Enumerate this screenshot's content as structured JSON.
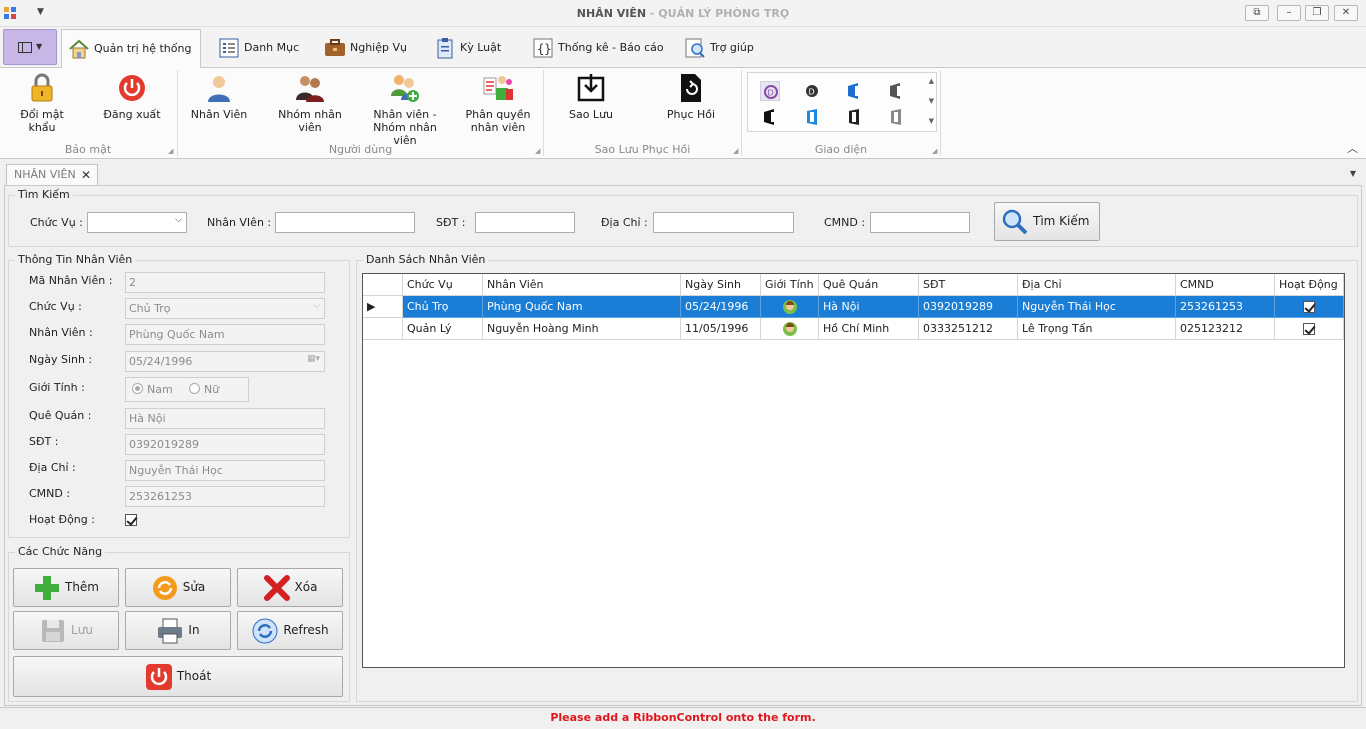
{
  "window": {
    "title_main": "NHÂN VIÊN",
    "title_sep": " - ",
    "title_sub": "QUẢN LÝ PHÒNG TRỌ",
    "buttons": [
      "restore-window",
      "minimize",
      "maximize",
      "close"
    ]
  },
  "tabs": [
    {
      "label": "Quản trị hệ thống",
      "active": true
    },
    {
      "label": "Danh Mục"
    },
    {
      "label": "Nghiệp Vụ"
    },
    {
      "label": "Kỳ Luật"
    },
    {
      "label": "Thống kê - Báo cáo"
    },
    {
      "label": "Trợ giúp"
    }
  ],
  "ribbon": {
    "groups": {
      "security": "Bảo mật",
      "users": "Người dùng",
      "backup": "Sao Lưu  Phục Hồi",
      "theme": "Giao diện"
    },
    "buttons": {
      "change_password": "Đổi mật khẩu",
      "logout": "Đăng xuất",
      "employee": "Nhân Viên",
      "group_l1": "Nhóm nhân",
      "group_l2": "viên",
      "emp_group_l1": "Nhân viên -",
      "emp_group_l2": "Nhóm nhân viên",
      "perm_l1": "Phân quyền",
      "perm_l2": "nhân viên",
      "backup": "Sao Lưu",
      "restore": "Phục Hồi"
    }
  },
  "doc_tab": {
    "label": "NHÂN VIÊN",
    "close": "✕"
  },
  "search": {
    "title": "Tìm Kiếm",
    "role_label": "Chức Vụ :",
    "role_value": "",
    "employee_label": "Nhân VIên :",
    "employee_value": "",
    "phone_label": "SĐT :",
    "phone_value": "",
    "address_label": "Địa Chỉ :",
    "address_value": "",
    "id_label": "CMND :",
    "id_value": "",
    "button": "Tìm Kiếm"
  },
  "info": {
    "title": "Thông Tin Nhân Viên",
    "id_label": "Mã Nhân Viên :",
    "id_value": "2",
    "role_label": "Chức Vụ :",
    "role_value": "Chủ Trọ",
    "name_label": "Nhân Viên :",
    "name_value": "Phùng Quốc Nam",
    "dob_label": "Ngày Sinh :",
    "dob_value": "05/24/1996",
    "gender_label": "Giới Tính :",
    "gender_male": "Nam",
    "gender_female": "Nữ",
    "hometown_label": "Quê Quán :",
    "hometown_value": "Hà Nội",
    "phone_label": "SĐT :",
    "phone_value": "0392019289",
    "address_label": "Địa Chỉ :",
    "address_value": "Nguyễn Thái Học",
    "cmnd_label": "CMND :",
    "cmnd_value": "253261253",
    "active_label": "Hoạt Động :",
    "active_checked": true
  },
  "functions": {
    "title": "Các Chức Năng",
    "add": "Thêm",
    "edit": "Sửa",
    "delete": "Xóa",
    "save": "Lưu",
    "print": "In",
    "refresh": "Refresh",
    "exit": "Thoát"
  },
  "grid": {
    "title": "Danh Sách Nhân Viên",
    "columns": [
      "Chức Vụ",
      "Nhân Viên",
      "Ngày Sinh",
      "Giới Tính",
      "Quê Quán",
      "SĐT",
      "Địa Chỉ",
      "CMND",
      "Hoạt Động"
    ],
    "rows": [
      {
        "role": "Chủ Trọ",
        "name": "Phùng Quốc Nam",
        "dob": "05/24/1996",
        "hometown": "Hà Nội",
        "phone": "0392019289",
        "address": "Nguyễn Thái Học",
        "cmnd": "253261253",
        "active": true,
        "selected": true
      },
      {
        "role": "Quản Lý",
        "name": "Nguyễn Hoàng Minh",
        "dob": "11/05/1996",
        "hometown": "Hồ Chí Minh",
        "phone": "0333251212",
        "address": "Lê Trọng Tấn",
        "cmnd": "025123212",
        "active": true,
        "selected": false
      }
    ]
  },
  "status": {
    "message": "Please add a RibbonControl onto the form."
  },
  "colors": {
    "selection": "#1a7ed6",
    "status_text": "#e0161c",
    "app_button": "#c7b7e6"
  }
}
